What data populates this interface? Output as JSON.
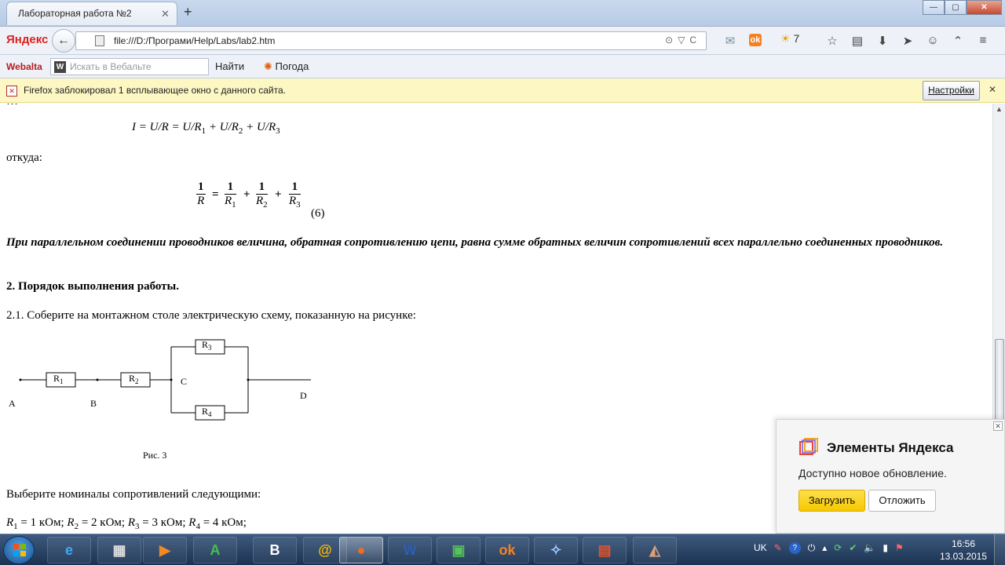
{
  "browser": {
    "tab_title": "Лабораторная работа №2",
    "tab_close": "✕",
    "new_tab": "+",
    "window_buttons": {
      "minimize": "—",
      "maximize": "▢",
      "close": "✕"
    },
    "yandex_logo": "Яндекс",
    "url": "file:///D:/Програми/Help/Labs/lab2.htm",
    "weather_temp": "7",
    "toolbar": {
      "webalta_logo": "Webalta",
      "search_icon_letter": "W",
      "search_placeholder": "Искать в Вебальте",
      "find_label": "Найти",
      "weather_label": "Погода"
    },
    "notification": {
      "text": "Firefox заблокировал 1 всплывающее окно с данного сайта.",
      "settings_label": "Настройки",
      "close": "✕"
    }
  },
  "page": {
    "clipped_top": "…",
    "formula_current": {
      "lhs": "I = U/R = U/R",
      "s1": "1",
      "mid1": " + U/R",
      "s2": "2",
      "mid2": " + U/R",
      "s3": "3"
    },
    "otkuda": "откуда:",
    "formula_reciprocal": {
      "one": "1",
      "eq": "=",
      "plus": "+",
      "r": "R",
      "sub1": "1",
      "sub2": "2",
      "sub3": "3",
      "number": "(6)"
    },
    "rule_text": "При параллельном соединении проводников величина, обратная сопротивлению цепи, равна сумме обратных величин сопротивлений всех параллельно соединенных проводников.",
    "section_heading": "2. Порядок выполнения работы.",
    "step_2_1": "2.1. Соберите на монтажном столе электрическую схему, показанную на рисунке:",
    "circuit": {
      "r1": "R",
      "r1_sub": "1",
      "r2": "R",
      "r2_sub": "2",
      "r3": "R",
      "r3_sub": "3",
      "r4": "R",
      "r4_sub": "4",
      "node_a": "A",
      "node_b": "B",
      "node_c": "C",
      "node_d": "D",
      "caption": "Рис. 3"
    },
    "choose_text": "Выберите номиналы сопротивлений следующими:",
    "values": [
      {
        "name": "R",
        "sub": "1",
        "text": " = 1 кОм; "
      },
      {
        "name": "R",
        "sub": "2",
        "text": " = 2 кОм; "
      },
      {
        "name": "R",
        "sub": "3",
        "text": " = 3 кОм; "
      },
      {
        "name": "R",
        "sub": "4",
        "text": " = 4 кОм;"
      }
    ]
  },
  "yandex_popup": {
    "title": "Элементы Яндекса",
    "text": "Доступно новое обновление.",
    "load_label": "Загрузить",
    "later_label": "Отложить"
  },
  "taskbar": {
    "apps": [
      {
        "name": "ie-icon",
        "glyph": "e",
        "color": "#3fa9f5"
      },
      {
        "name": "film-icon",
        "glyph": "▦",
        "color": "#dddddd"
      },
      {
        "name": "play-icon",
        "glyph": "▶",
        "color": "#f08a24"
      },
      {
        "name": "a-icon",
        "glyph": "A",
        "color": "#43c04a"
      },
      {
        "name": "vk-icon",
        "glyph": "B",
        "color": "#ffffff"
      },
      {
        "name": "mail-at-icon",
        "glyph": "@",
        "color": "#f5b800"
      },
      {
        "name": "firefox-icon",
        "glyph": "●",
        "color": "#f36b21"
      },
      {
        "name": "word-icon",
        "glyph": "W",
        "color": "#2b5fb3"
      },
      {
        "name": "monitor-icon",
        "glyph": "▣",
        "color": "#55c35a"
      },
      {
        "name": "odnoklassniki-icon",
        "glyph": "ok",
        "color": "#f58220"
      },
      {
        "name": "emblem-icon",
        "glyph": "✧",
        "color": "#9ec9ff"
      },
      {
        "name": "presentation-icon",
        "glyph": "▤",
        "color": "#e0542f"
      },
      {
        "name": "network-icon",
        "glyph": "◭",
        "color": "#d9a07a"
      }
    ],
    "tray_lang": "UK",
    "clock_time": "16:56",
    "clock_date": "13.03.2015"
  }
}
